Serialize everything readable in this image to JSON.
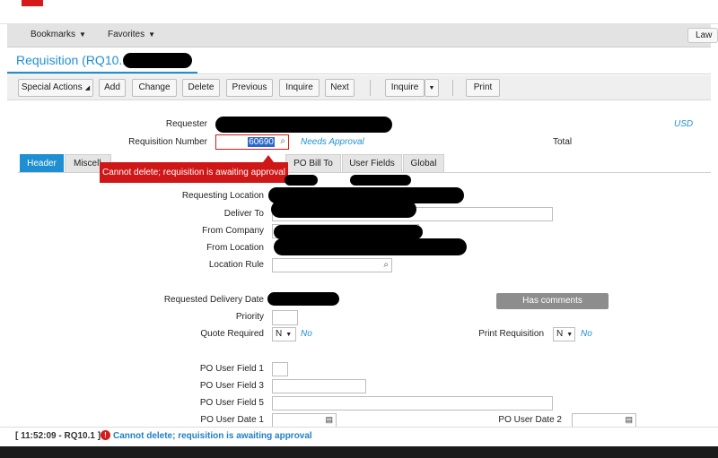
{
  "menubar": {
    "bookmarks": "Bookmarks",
    "favorites": "Favorites",
    "right_button": "Law"
  },
  "page": {
    "title": "Requisition (RQ10.1"
  },
  "toolbar": {
    "special_actions": "Special Actions",
    "add": "Add",
    "change": "Change",
    "delete": "Delete",
    "previous": "Previous",
    "inquire": "Inquire",
    "next": "Next",
    "inquire_dropdown": "Inquire",
    "print": "Print"
  },
  "header": {
    "requester_label": "Requester",
    "requisition_number_label": "Requisition Number",
    "requisition_number_value": "60690",
    "status_link": "Needs Approval",
    "currency": "USD",
    "total_label": "Total"
  },
  "tabs": [
    "Header",
    "Miscell",
    "PO Bill To",
    "User Fields",
    "Global"
  ],
  "error_tooltip": "Cannot delete; requisition is awaiting approval",
  "form": {
    "requesting_location_label": "Requesting Location",
    "deliver_to_label": "Deliver To",
    "from_company_label": "From Company",
    "from_location_label": "From Location",
    "location_rule_label": "Location Rule",
    "requested_delivery_date_label": "Requested Delivery Date",
    "has_comments": "Has comments",
    "priority_label": "Priority",
    "quote_required_label": "Quote Required",
    "quote_required_value": "N",
    "quote_required_text": "No",
    "print_requisition_label": "Print Requisition",
    "print_requisition_value": "N",
    "print_requisition_text": "No",
    "po_user_field_1_label": "PO User Field 1",
    "po_user_field_3_label": "PO User Field 3",
    "po_user_field_5_label": "PO User Field 5",
    "po_user_date_1_label": "PO User Date 1",
    "po_user_date_2_label": "PO User Date 2"
  },
  "statusbar": {
    "prefix": "[ 11:52:09 - RQ10.1 ]",
    "message": "Cannot delete; requisition is awaiting approval"
  },
  "colors": {
    "accent": "#1f8fd3",
    "error": "#cf1717"
  }
}
